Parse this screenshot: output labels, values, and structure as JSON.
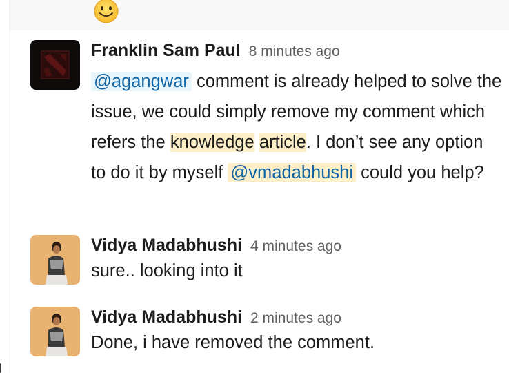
{
  "reaction": {
    "emoji": "slightly-smiling-face"
  },
  "messages": [
    {
      "author": "Franklin Sam Paul",
      "time": "8 minutes ago",
      "avatar": "dota-logo",
      "parts": {
        "mention1": "@agangwar",
        "t1": " comment is already helped to solve the issue, we could simply remove my comment which refers the ",
        "hl1": "knowledge",
        "sp": " ",
        "hl2": "article",
        "t2": ".  I don’t see any option to do it by myself ",
        "mention2": "@vmadabhushi",
        "t3": " could you help?"
      }
    },
    {
      "author": "Vidya Madabhushi",
      "time": "4 minutes ago",
      "avatar": "user-photo",
      "text": "sure.. looking into it"
    },
    {
      "author": "Vidya Madabhushi",
      "time": "2 minutes ago",
      "avatar": "user-photo",
      "text": "Done, i have removed the comment."
    }
  ],
  "colors": {
    "mention": "#1264a3",
    "mention_bg": "#e8f5fa",
    "highlight_bg": "#fcefc7",
    "timestamp": "#616061"
  }
}
